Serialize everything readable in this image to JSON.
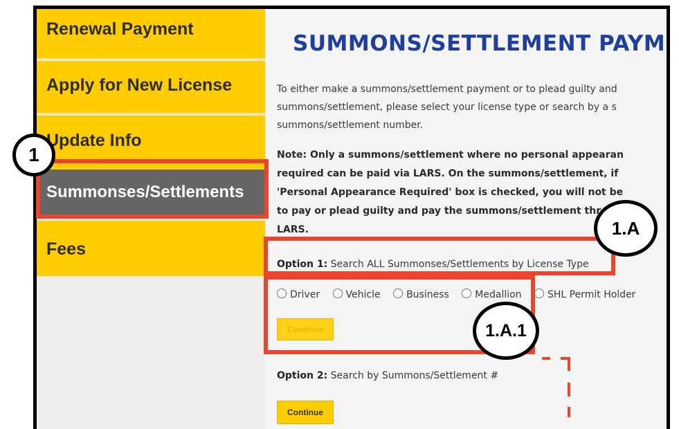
{
  "sidebar": {
    "items": [
      {
        "label": "Renewal Payment"
      },
      {
        "label": "Apply for New License"
      },
      {
        "label": "Update Info"
      },
      {
        "label": "Summonses/Settlements"
      },
      {
        "label": "Fees"
      }
    ]
  },
  "main": {
    "title": "SUMMONS/SETTLEMENT PAYME",
    "intro_lines": [
      "To either make a summons/settlement payment or to plead guilty and",
      "summons/settlement, please select your license type or search by a s",
      "summons/settlement number."
    ],
    "note_lines": [
      "Note: Only a summons/settlement where no personal appearan",
      "required can be paid via LARS. On the summons/settlement, if",
      "'Personal Appearance Required' box is checked, you will not be",
      "to pay or plead guilty and pay the summons/settlement through",
      "LARS."
    ],
    "option1": {
      "prefix": "Option 1:",
      "text": "Search ALL Summonses/Settlements by License Type"
    },
    "license_types": [
      "Driver",
      "Vehicle",
      "Business",
      "Medallion",
      "SHL Permit Holder"
    ],
    "continue1_label": "Continue",
    "option2": {
      "prefix": "Option 2:",
      "text": "Search by Summons/Settlement #"
    },
    "continue2_label": "Continue"
  },
  "annotations": {
    "badge_1": "1",
    "badge_1a": "1.A",
    "badge_1a1": "1.A.1",
    "highlight_color": "#e8462e"
  }
}
